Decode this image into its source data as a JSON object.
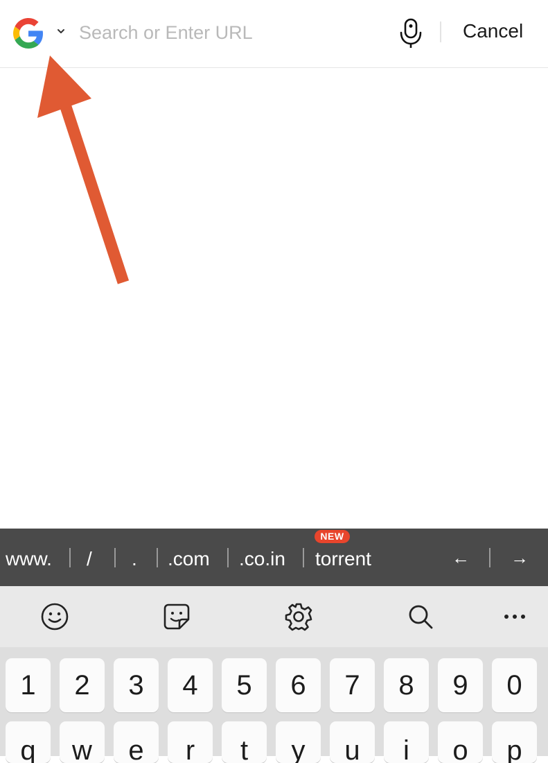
{
  "search": {
    "placeholder": "Search or Enter URL",
    "value": "",
    "cancel_label": "Cancel",
    "engine_icon": "google-g-icon",
    "mic_icon": "microphone-icon"
  },
  "annotation": {
    "arrow_color": "#e05a33"
  },
  "suggestions": {
    "chips": [
      "www.",
      "/",
      ".",
      ".com",
      ".co.in",
      "torrent"
    ],
    "new_badge": "NEW",
    "left_arrow": "←",
    "right_arrow": "→"
  },
  "keyboard_toolbar": {
    "icons": [
      "emoji-icon",
      "sticker-icon",
      "settings-gear-icon",
      "search-icon",
      "more-icon"
    ]
  },
  "keys": {
    "numbers": [
      "1",
      "2",
      "3",
      "4",
      "5",
      "6",
      "7",
      "8",
      "9",
      "0"
    ],
    "letters": [
      "q",
      "w",
      "e",
      "r",
      "t",
      "y",
      "u",
      "i",
      "o",
      "p"
    ]
  },
  "colors": {
    "suggest_bar_bg": "#4a4a4a",
    "badge_red": "#e8452c",
    "keyboard_bg": "#dedede"
  }
}
